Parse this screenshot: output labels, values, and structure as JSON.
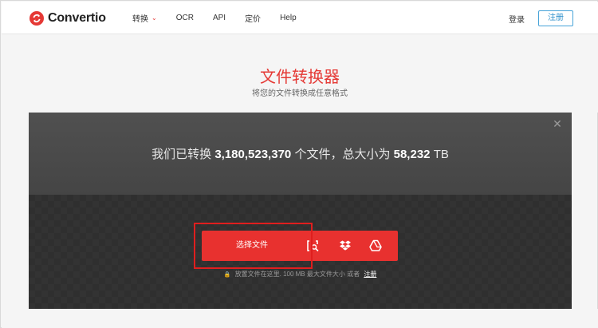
{
  "brand": {
    "name": "Convertio",
    "accent": "#e53935"
  },
  "nav": {
    "items": [
      {
        "label": "转换",
        "has_dropdown": true
      },
      {
        "label": "OCR"
      },
      {
        "label": "API"
      },
      {
        "label": "定价"
      },
      {
        "label": "Help"
      }
    ],
    "login": "登录",
    "register": "注册"
  },
  "hero": {
    "title": "文件转换器",
    "subtitle": "将您的文件转换成任意格式"
  },
  "stats": {
    "prefix": "我们已转换",
    "files_count": "3,180,523,370",
    "middle": "个文件，总大小为",
    "total_size": "58,232",
    "unit": "TB"
  },
  "upload": {
    "choose_label": "选择文件",
    "icons": [
      "scan-url-icon",
      "dropbox-icon",
      "google-drive-icon"
    ],
    "hint_text": "放置文件在这里. 100 MB 最大文件大小 或者",
    "hint_link": "注册"
  },
  "colors": {
    "panel_dark": "#3a3a3a",
    "upload_red": "#e8312f",
    "highlight_box": "#e01e1e",
    "register_blue": "#2d8fcb"
  }
}
